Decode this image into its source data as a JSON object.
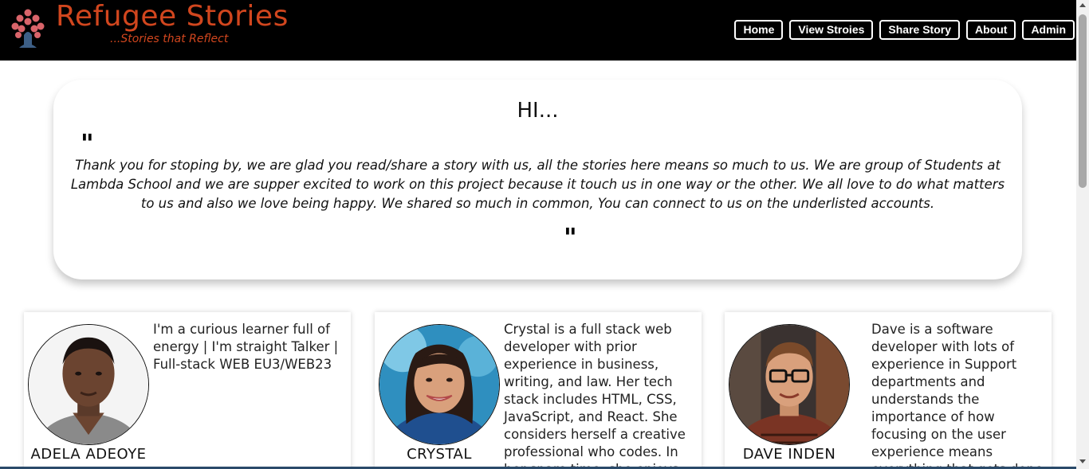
{
  "header": {
    "brand_title": "Refugee Stories",
    "brand_tagline": "...Stories that Reflect",
    "brand_color": "#d1461e",
    "logo_icon": "tree-people-logo"
  },
  "nav": {
    "home": "Home",
    "view_stories": "View Stroies",
    "share_story": "Share Story",
    "about": "About",
    "admin": "Admin"
  },
  "greeting": {
    "title": "HI...",
    "open_quote": "\"",
    "close_quote": "\"",
    "body": "Thank you for stoping by, we are glad you read/share a story with us, all the stories here means so much to us. We are group of Students at Lambda School and we are supper excited to work on this project because it touch us in one way or the other. We all love to do what matters to us and also we love being happy. We shared so much in common, You can connect to us on the underlisted accounts."
  },
  "team": [
    {
      "name": "ADELA ADEOYE",
      "bio": "I'm a curious learner full of energy | I'm straight Talker | Full-stack WEB EU3/WEB23"
    },
    {
      "name": "CRYSTAL",
      "bio": "Crystal is a full stack web developer with prior experience in business, writing, and law. Her tech stack includes HTML, CSS, JavaScript, and React. She considers herself a creative professional who codes. In her spare time, she enjoys"
    },
    {
      "name": "DAVE INDEN",
      "bio": "Dave is a software developer with lots of experience in Support departments and understands the importance of how focusing on the user experience means everything that gets done"
    }
  ]
}
